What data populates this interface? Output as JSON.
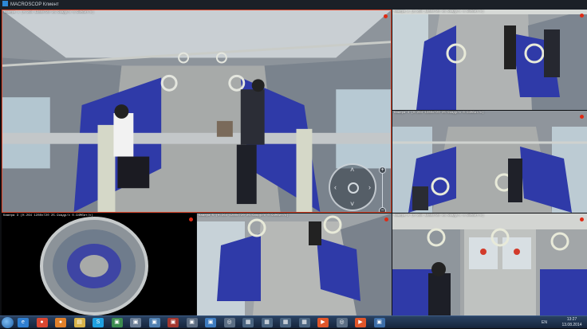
{
  "app": {
    "title": "MACROSCOP Клиент"
  },
  "cameras": [
    {
      "id": "main",
      "header": "Камера 1 (H.264 1280x720 25.9кадр/с 0.94Мбит/с)"
    },
    {
      "id": "top-right",
      "header": "Камера 2 (H.264 1280x720 25.9кадр/с 0.94Мбит/с)"
    },
    {
      "id": "mid-right",
      "header": "Камера 4 (H.264 1280x720 25.9кадр/с 0.94Мбит/с)"
    },
    {
      "id": "fisheye",
      "header": "Камера 3 (H.264 1280x720 25.9кадр/с 0.94Мбит/с)"
    },
    {
      "id": "bottom-mid",
      "header": "Камера 5 (H.264 1280x720 25.9кадр/с 0.94Мбит/с)"
    },
    {
      "id": "bottom-right",
      "header": "Камера 6 (H.264 1280x720 25.9кадр/с 0.94Мбит/с)"
    }
  ],
  "ptz": {
    "left": "‹",
    "right": "›",
    "up": "˄",
    "down": "˅",
    "zoom_in": "+",
    "zoom_out": "−"
  },
  "taskbar": {
    "icons": [
      {
        "name": "ie-icon",
        "glyph": "e",
        "color": "#2f7fd1"
      },
      {
        "name": "chrome-icon",
        "glyph": "●",
        "color": "#d94732"
      },
      {
        "name": "firefox-icon",
        "glyph": "●",
        "color": "#e0802a"
      },
      {
        "name": "explorer-icon",
        "glyph": "▤",
        "color": "#d6b24a"
      },
      {
        "name": "skype-icon",
        "glyph": "S",
        "color": "#1fa0e0"
      },
      {
        "name": "app-icon",
        "glyph": "▣",
        "color": "#3c8b4f"
      },
      {
        "name": "app-icon",
        "glyph": "▣",
        "color": "#6a7d95"
      },
      {
        "name": "app-icon",
        "glyph": "▣",
        "color": "#4f7fb0"
      },
      {
        "name": "app-icon",
        "glyph": "▣",
        "color": "#a3372f"
      },
      {
        "name": "app-icon",
        "glyph": "▣",
        "color": "#5d6d82"
      },
      {
        "name": "app-icon",
        "glyph": "▣",
        "color": "#3d7bbf"
      },
      {
        "name": "app-icon",
        "glyph": "◎",
        "color": "#5b6e84"
      },
      {
        "name": "app-icon",
        "glyph": "▦",
        "color": "#4a6480"
      },
      {
        "name": "app-icon",
        "glyph": "▦",
        "color": "#4a6480"
      },
      {
        "name": "app-icon",
        "glyph": "▦",
        "color": "#4a6480"
      },
      {
        "name": "app-icon",
        "glyph": "▦",
        "color": "#4a6480"
      },
      {
        "name": "app-icon",
        "glyph": "▶",
        "color": "#e0562a"
      },
      {
        "name": "app-icon",
        "glyph": "◎",
        "color": "#5b6e84"
      },
      {
        "name": "app-icon",
        "glyph": "▶",
        "color": "#e0562a"
      },
      {
        "name": "app-icon",
        "glyph": "▣",
        "color": "#3d6ea8"
      }
    ],
    "lang": "EN",
    "time": "13:27",
    "date": "13.08.2014"
  }
}
